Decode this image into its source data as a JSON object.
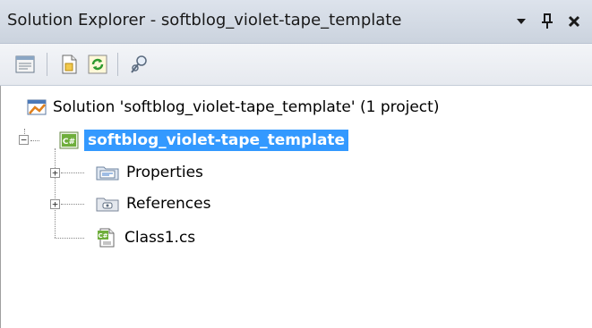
{
  "window": {
    "title": "Solution Explorer - softblog_violet-tape_template",
    "dropdown_icon": "dropdown-arrow-icon",
    "pin_icon": "pin-icon",
    "close_icon": "close-icon"
  },
  "toolbar": {
    "buttons": [
      {
        "icon": "properties-icon"
      },
      {
        "icon": "show-all-files-icon"
      },
      {
        "icon": "refresh-icon"
      },
      {
        "icon": "class-view-icon"
      }
    ]
  },
  "tree": {
    "solution": {
      "label": "Solution 'softblog_violet-tape_template' (1 project)",
      "icon": "solution-icon"
    },
    "project": {
      "label": "softblog_violet-tape_template",
      "icon": "csharp-project-icon",
      "expanded": true,
      "selected": true
    },
    "items": [
      {
        "label": "Properties",
        "icon": "properties-folder-icon",
        "expandable": true
      },
      {
        "label": "References",
        "icon": "references-folder-icon",
        "expandable": true
      },
      {
        "label": "Class1.cs",
        "icon": "csharp-file-icon",
        "expandable": false
      }
    ]
  },
  "colors": {
    "selection": "#3399ff",
    "titlebar": "#d5dce6"
  }
}
